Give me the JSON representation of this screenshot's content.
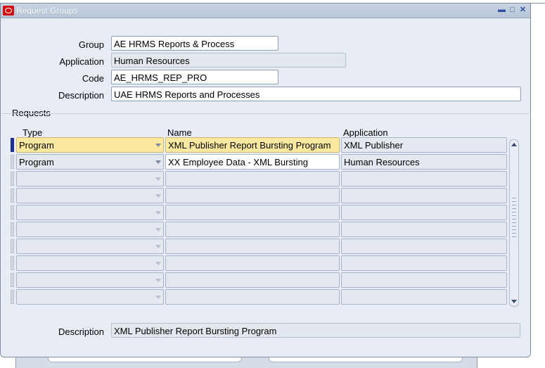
{
  "window": {
    "title": "Request Groups"
  },
  "header_fields": {
    "group": {
      "label": "Group",
      "value": "AE HRMS Reports & Process"
    },
    "application": {
      "label": "Application",
      "value": "Human Resources"
    },
    "code": {
      "label": "Code",
      "value": "AE_HRMS_REP_PRO"
    },
    "description": {
      "label": "Description",
      "value": "UAE HRMS Reports and Processes"
    }
  },
  "requests": {
    "section_title": "Requests",
    "columns": {
      "type": "Type",
      "name": "Name",
      "application": "Application"
    },
    "rows": [
      {
        "type": "Program",
        "name": "XML Publisher Report Bursting Program",
        "application": "XML Publisher"
      },
      {
        "type": "Program",
        "name": "XX Employee Data - XML Bursting",
        "application": "Human Resources"
      },
      {
        "type": "",
        "name": "",
        "application": ""
      },
      {
        "type": "",
        "name": "",
        "application": ""
      },
      {
        "type": "",
        "name": "",
        "application": ""
      },
      {
        "type": "",
        "name": "",
        "application": ""
      },
      {
        "type": "",
        "name": "",
        "application": ""
      },
      {
        "type": "",
        "name": "",
        "application": ""
      },
      {
        "type": "",
        "name": "",
        "application": ""
      },
      {
        "type": "",
        "name": "",
        "application": ""
      }
    ]
  },
  "footer": {
    "description_label": "Description",
    "description_value": "XML Publisher Report Bursting Program"
  },
  "colors": {
    "selected_cell": "#fbe9a0",
    "title_bar": "#c8d3e2",
    "window_bg": "#e8ecf4",
    "active_row_indicator": "#1f2f90"
  }
}
